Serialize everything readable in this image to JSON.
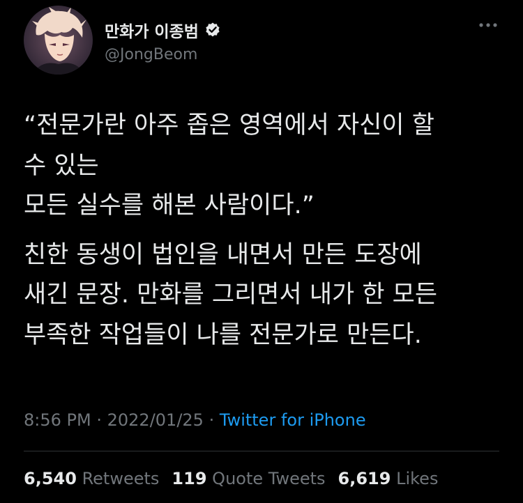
{
  "author": {
    "display_name": "만화가 이종범",
    "handle": "@JongBeom",
    "verified": true,
    "avatar_icon": "user-avatar"
  },
  "tweet": {
    "paragraph_1": "“전문가란 아주 좁은 영역에서 자신이 할\n수 있는\n모든 실수를 해본 사람이다.”",
    "paragraph_2": "친한 동생이 법인을 내면서 만든 도장에\n새긴 문장. 만화를 그리면서 내가 한 모든\n부족한 작업들이 나를 전문가로 만든다."
  },
  "meta": {
    "time": "8:56 PM",
    "separator": "·",
    "date": "2022/01/25",
    "source": "Twitter for iPhone"
  },
  "stats": {
    "retweets_count": "6,540",
    "retweets_label": "Retweets",
    "quotes_count": "119",
    "quotes_label": "Quote Tweets",
    "likes_count": "6,619",
    "likes_label": "Likes"
  },
  "colors": {
    "background": "#000000",
    "text_primary": "#e7e9ea",
    "text_secondary": "#71767b",
    "link": "#1d9bf0",
    "divider": "#2f3336"
  }
}
